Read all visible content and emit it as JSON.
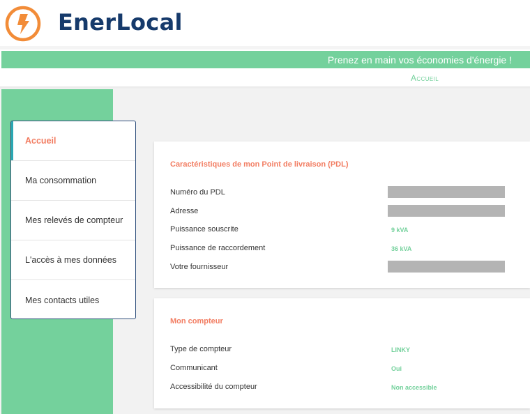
{
  "header": {
    "brand": "EnerLocal",
    "logo_icon": "lightning-bolt-icon",
    "brand_color": "#163a6b",
    "logo_color": "#f28c38"
  },
  "banner": {
    "text": "Prenez en main vos économies d'énergie !",
    "color": "#74d19c"
  },
  "breadcrumb": {
    "current": "Accueil"
  },
  "sidebar": {
    "items": [
      {
        "label": "Accueil",
        "active": true
      },
      {
        "label": "Ma consommation",
        "active": false
      },
      {
        "label": "Mes relevés de compteur",
        "active": false
      },
      {
        "label": "L'accès à mes données",
        "active": false
      },
      {
        "label": "Mes contacts utiles",
        "active": false
      }
    ]
  },
  "pdl_card": {
    "title": "Caractéristiques de mon Point de livraison (PDL)",
    "rows": [
      {
        "label": "Numéro du PDL",
        "value": null,
        "redacted": true
      },
      {
        "label": "Adresse",
        "value": null,
        "redacted": true
      },
      {
        "label": "Puissance souscrite",
        "value": "9 kVA",
        "redacted": false
      },
      {
        "label": "Puissance de raccordement",
        "value": "36 kVA",
        "redacted": false
      },
      {
        "label": "Votre fournisseur",
        "value": null,
        "redacted": true
      }
    ]
  },
  "meter_card": {
    "title": "Mon compteur",
    "rows": [
      {
        "label": "Type de compteur",
        "value": "LINKY"
      },
      {
        "label": "Communicant",
        "value": "Oui"
      },
      {
        "label": "Accessibilité du compteur",
        "value": "Non accessible"
      }
    ]
  },
  "colors": {
    "accent_green": "#74d19c",
    "accent_orange": "#f27d62",
    "active_marker": "#2aa7b3",
    "menu_border": "#2f4f7c"
  }
}
